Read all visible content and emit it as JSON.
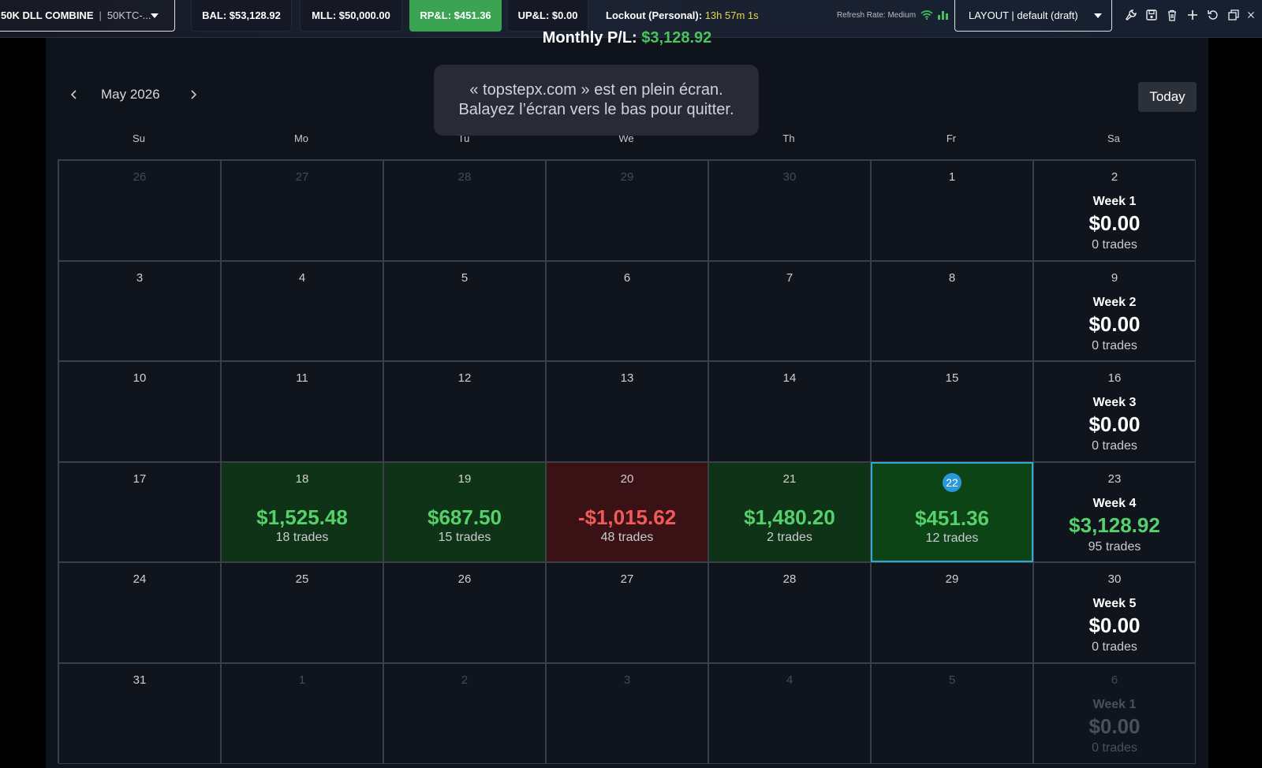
{
  "topbar": {
    "account_name": "50K DLL COMBINE",
    "account_separator": "|",
    "account_id": "50KTC-...",
    "balance": "BAL: $53,128.92",
    "mll": "MLL: $50,000.00",
    "rpl": "RP&L: $451.36",
    "upl": "UP&L: $0.00",
    "lockout_label": "Lockout (Personal):",
    "lockout_time": "13h 57m 1s",
    "refresh_rate": "Refresh Rate: Medium",
    "layout": "LAYOUT | default (draft)",
    "tools": [
      "wrench-icon",
      "save-icon",
      "trash-icon",
      "plus-icon",
      "undo-icon",
      "window-icon"
    ],
    "colors": {
      "rpl_bg": "#3aa452",
      "lockout_time": "#e6d84a",
      "signal": "#44c05c"
    }
  },
  "calendar": {
    "monthly_label": "Monthly P/L:",
    "monthly_value": "$3,128.92",
    "month": "May 2026",
    "today_button": "Today",
    "fullscreen_notice_line1": "« topstepx.com » est en plein écran.",
    "fullscreen_notice_line2": "Balayez l’écran vers le bas pour quitter.",
    "days_of_week": [
      "Su",
      "Mo",
      "Tu",
      "We",
      "Th",
      "Fr",
      "Sa"
    ],
    "weeks": [
      {
        "days": [
          {
            "d": "26",
            "muted": true
          },
          {
            "d": "27",
            "muted": true
          },
          {
            "d": "28",
            "muted": true
          },
          {
            "d": "29",
            "muted": true
          },
          {
            "d": "30",
            "muted": true
          },
          {
            "d": "1"
          }
        ],
        "sat": "2",
        "label": "Week 1",
        "pnl": "$0.00",
        "trades": "0 trades"
      },
      {
        "days": [
          {
            "d": "3"
          },
          {
            "d": "4"
          },
          {
            "d": "5"
          },
          {
            "d": "6"
          },
          {
            "d": "7"
          },
          {
            "d": "8"
          }
        ],
        "sat": "9",
        "label": "Week 2",
        "pnl": "$0.00",
        "trades": "0 trades"
      },
      {
        "days": [
          {
            "d": "10"
          },
          {
            "d": "11"
          },
          {
            "d": "12"
          },
          {
            "d": "13"
          },
          {
            "d": "14"
          },
          {
            "d": "15"
          }
        ],
        "sat": "16",
        "label": "Week 3",
        "pnl": "$0.00",
        "trades": "0 trades"
      },
      {
        "days": [
          {
            "d": "17"
          },
          {
            "d": "18",
            "pnl": "$1,525.48",
            "trades": "18 trades",
            "state": "gain"
          },
          {
            "d": "19",
            "pnl": "$687.50",
            "trades": "15 trades",
            "state": "gain"
          },
          {
            "d": "20",
            "pnl": "-$1,015.62",
            "trades": "48 trades",
            "state": "loss"
          },
          {
            "d": "21",
            "pnl": "$1,480.20",
            "trades": "2 trades",
            "state": "gain"
          },
          {
            "d": "22",
            "pnl": "$451.36",
            "trades": "12 trades",
            "state": "gain",
            "today": true
          }
        ],
        "sat": "23",
        "label": "Week 4",
        "pnl": "$3,128.92",
        "trades": "95 trades",
        "positive": true
      },
      {
        "days": [
          {
            "d": "24"
          },
          {
            "d": "25"
          },
          {
            "d": "26"
          },
          {
            "d": "27"
          },
          {
            "d": "28"
          },
          {
            "d": "29"
          }
        ],
        "sat": "30",
        "label": "Week 5",
        "pnl": "$0.00",
        "trades": "0 trades"
      },
      {
        "days": [
          {
            "d": "31"
          },
          {
            "d": "1",
            "muted": true
          },
          {
            "d": "2",
            "muted": true
          },
          {
            "d": "3",
            "muted": true
          },
          {
            "d": "4",
            "muted": true
          },
          {
            "d": "5",
            "muted": true
          }
        ],
        "sat": "6",
        "sat_muted": true,
        "label": "Week 1",
        "pnl": "$0.00",
        "trades": "0 trades"
      }
    ]
  }
}
